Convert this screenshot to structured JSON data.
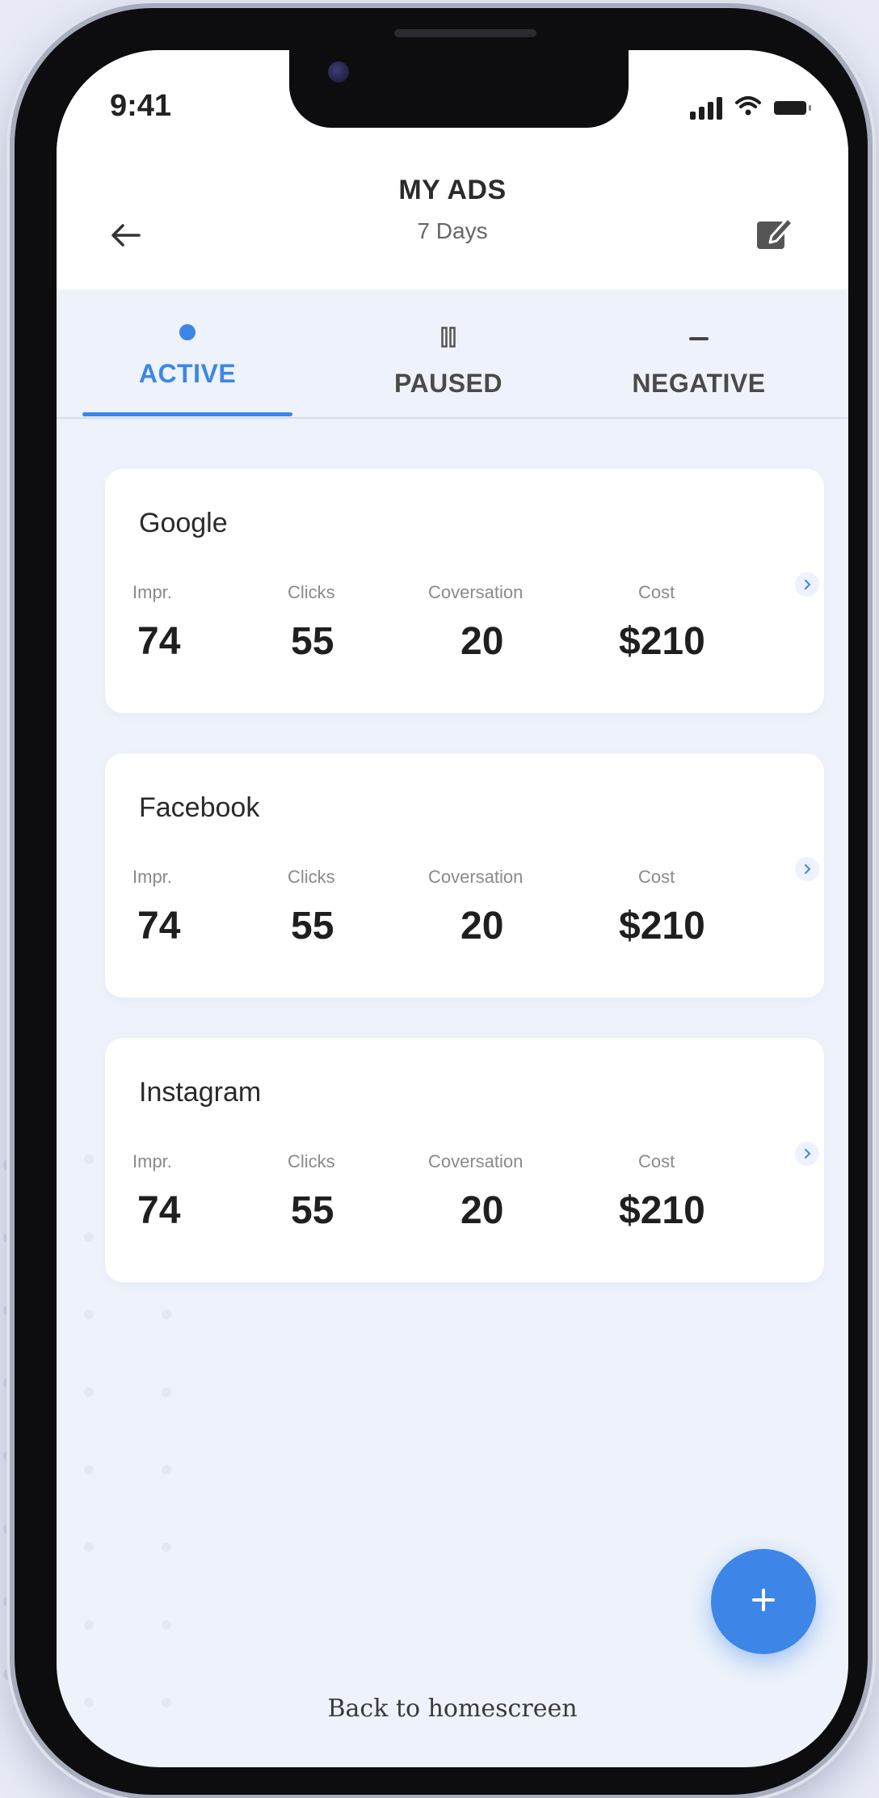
{
  "status_bar": {
    "time": "9:41",
    "icons": [
      "signal-icon",
      "wifi-icon",
      "battery-icon"
    ]
  },
  "header": {
    "title": "MY ADS",
    "subtitle": "7 Days",
    "back_icon": "arrow-left-icon",
    "edit_icon": "edit-icon"
  },
  "tabs": [
    {
      "label": "ACTIVE",
      "icon": "dot-icon",
      "active": true
    },
    {
      "label": "PAUSED",
      "icon": "pause-icon",
      "active": false
    },
    {
      "label": "NEGATIVE",
      "icon": "minus-icon",
      "active": false
    }
  ],
  "ads": [
    {
      "platform": "Google",
      "metrics": [
        {
          "label": "Impr.",
          "value": "74"
        },
        {
          "label": "Clicks",
          "value": "55"
        },
        {
          "label": "Coversation",
          "value": "20"
        },
        {
          "label": "Cost",
          "value": "$210"
        }
      ]
    },
    {
      "platform": "Facebook",
      "metrics": [
        {
          "label": "Impr.",
          "value": "74"
        },
        {
          "label": "Clicks",
          "value": "55"
        },
        {
          "label": "Coversation",
          "value": "20"
        },
        {
          "label": "Cost",
          "value": "$210"
        }
      ]
    },
    {
      "platform": "Instagram",
      "metrics": [
        {
          "label": "Impr.",
          "value": "74"
        },
        {
          "label": "Clicks",
          "value": "55"
        },
        {
          "label": "Coversation",
          "value": "20"
        },
        {
          "label": "Cost",
          "value": "$210"
        }
      ]
    }
  ],
  "fab": {
    "icon": "plus-icon"
  },
  "footer": {
    "home_link": "Back to homescreen"
  },
  "colors": {
    "accent": "#3d86e8",
    "background": "#eef3fb",
    "card": "#ffffff"
  }
}
